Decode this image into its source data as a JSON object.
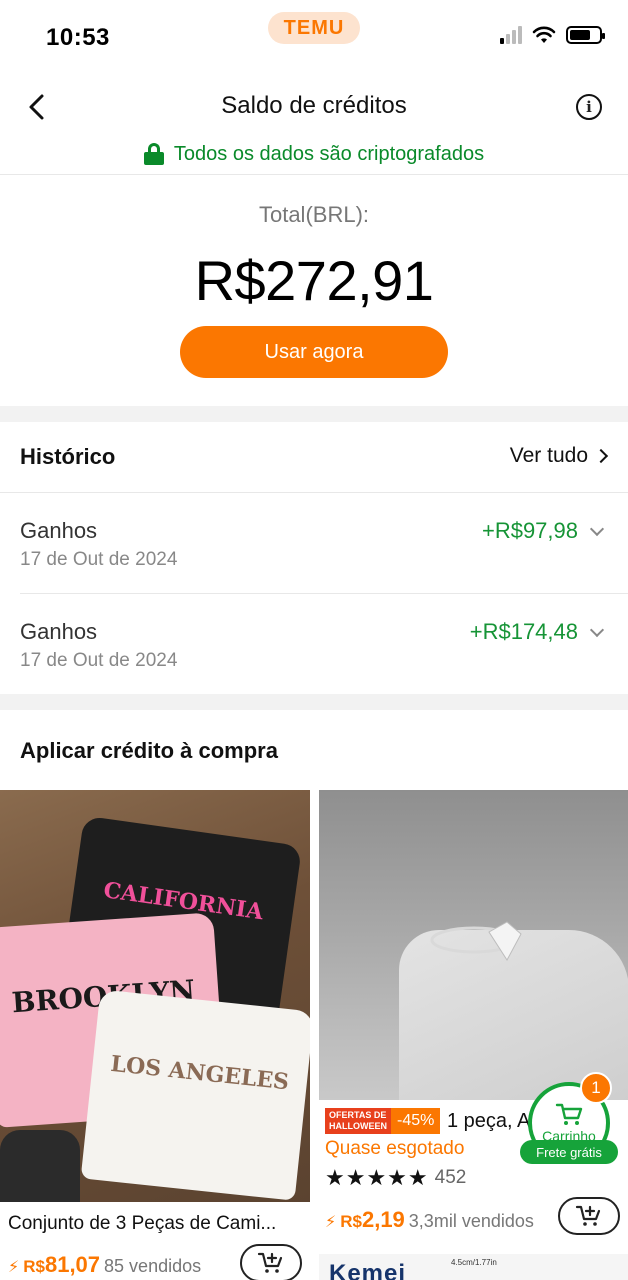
{
  "status_bar": {
    "time": "10:53",
    "brand": "TEMU"
  },
  "header": {
    "title": "Saldo de créditos",
    "secure_text": "Todos os dados são criptografados"
  },
  "balance": {
    "label": "Total(BRL):",
    "amount": "R$272,91",
    "use_button": "Usar agora"
  },
  "history": {
    "title": "Histórico",
    "see_all": "Ver tudo",
    "items": [
      {
        "type": "Ganhos",
        "date": "17 de Out de 2024",
        "amount": "+R$97,98"
      },
      {
        "type": "Ganhos",
        "date": "17 de Out de 2024",
        "amount": "+R$174,48"
      }
    ]
  },
  "apply": {
    "title": "Aplicar crédito à compra",
    "products": [
      {
        "name": "Conjunto de 3 Peças de Cami...",
        "currency": "R$",
        "price": "81,07",
        "sold": "85 vendidos",
        "shirt_texts": [
          "CALIFORNIA",
          "BROOKLYN",
          "LOS ANGELES"
        ]
      },
      {
        "badge_line1": "OFERTAS DE",
        "badge_line2": "HALLOWEEN",
        "discount": "-45%",
        "name": "1 peça, A",
        "stock": "Quase esgotado",
        "stars": "★★★★★",
        "reviews": "452",
        "currency": "R$",
        "price": "2,19",
        "sold": "3,3mil vendidos"
      }
    ],
    "next_brand": "Kemei",
    "next_size": "4.5cm/1.77in"
  },
  "floating_cart": {
    "label": "Carrinho",
    "count": "1",
    "free_shipping": "Frete grátis"
  },
  "colors": {
    "accent": "#fb7701",
    "green": "#169436"
  }
}
